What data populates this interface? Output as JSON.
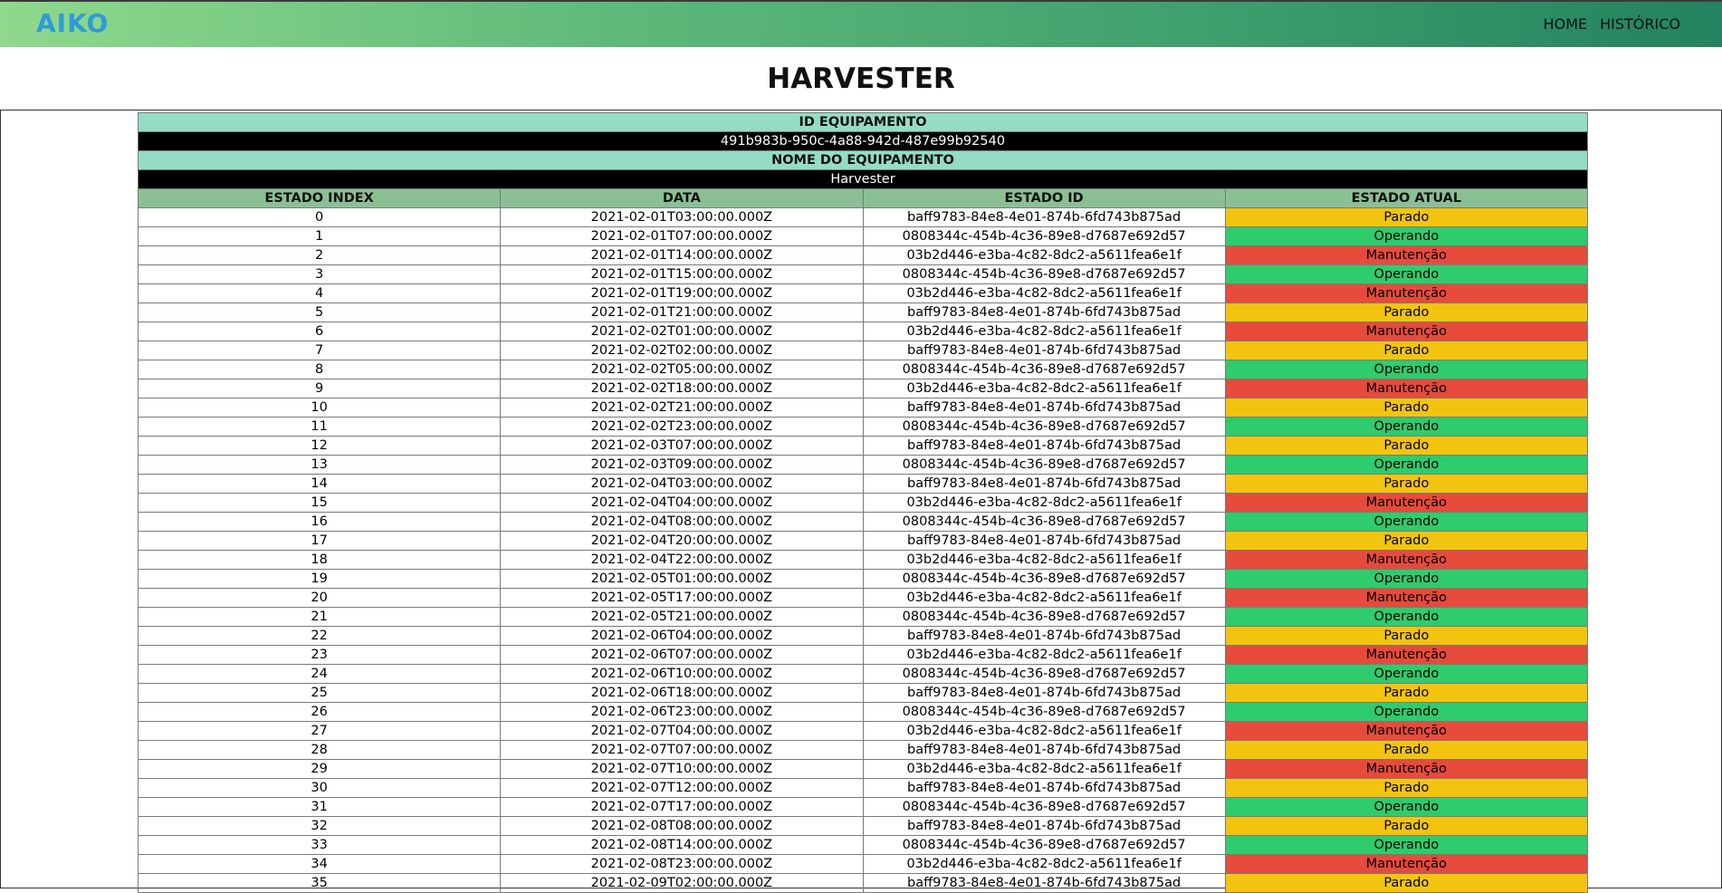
{
  "navbar": {
    "logo": "AIKO",
    "links": [
      {
        "label": "HOME"
      },
      {
        "label": "HISTÓRICO"
      }
    ]
  },
  "page": {
    "title": "HARVESTER"
  },
  "equipment": {
    "id_label": "ID EQUIPAMENTO",
    "id_value": "491b983b-950c-4a88-942d-487e99b92540",
    "name_label": "NOME DO EQUIPAMENTO",
    "name_value": "Harvester"
  },
  "table": {
    "headers": [
      "ESTADO INDEX",
      "DATA",
      "ESTADO ID",
      "ESTADO ATUAL"
    ],
    "state_colors": {
      "Parado": "#f3c40f",
      "Operando": "#2ecc6c",
      "Manutenção": "#e64b3c"
    },
    "rows": [
      {
        "index": "0",
        "date": "2021-02-01T03:00:00.000Z",
        "state_id": "baff9783-84e8-4e01-874b-6fd743b875ad",
        "state": "Parado"
      },
      {
        "index": "1",
        "date": "2021-02-01T07:00:00.000Z",
        "state_id": "0808344c-454b-4c36-89e8-d7687e692d57",
        "state": "Operando"
      },
      {
        "index": "2",
        "date": "2021-02-01T14:00:00.000Z",
        "state_id": "03b2d446-e3ba-4c82-8dc2-a5611fea6e1f",
        "state": "Manutenção"
      },
      {
        "index": "3",
        "date": "2021-02-01T15:00:00.000Z",
        "state_id": "0808344c-454b-4c36-89e8-d7687e692d57",
        "state": "Operando"
      },
      {
        "index": "4",
        "date": "2021-02-01T19:00:00.000Z",
        "state_id": "03b2d446-e3ba-4c82-8dc2-a5611fea6e1f",
        "state": "Manutenção"
      },
      {
        "index": "5",
        "date": "2021-02-01T21:00:00.000Z",
        "state_id": "baff9783-84e8-4e01-874b-6fd743b875ad",
        "state": "Parado"
      },
      {
        "index": "6",
        "date": "2021-02-02T01:00:00.000Z",
        "state_id": "03b2d446-e3ba-4c82-8dc2-a5611fea6e1f",
        "state": "Manutenção"
      },
      {
        "index": "7",
        "date": "2021-02-02T02:00:00.000Z",
        "state_id": "baff9783-84e8-4e01-874b-6fd743b875ad",
        "state": "Parado"
      },
      {
        "index": "8",
        "date": "2021-02-02T05:00:00.000Z",
        "state_id": "0808344c-454b-4c36-89e8-d7687e692d57",
        "state": "Operando"
      },
      {
        "index": "9",
        "date": "2021-02-02T18:00:00.000Z",
        "state_id": "03b2d446-e3ba-4c82-8dc2-a5611fea6e1f",
        "state": "Manutenção"
      },
      {
        "index": "10",
        "date": "2021-02-02T21:00:00.000Z",
        "state_id": "baff9783-84e8-4e01-874b-6fd743b875ad",
        "state": "Parado"
      },
      {
        "index": "11",
        "date": "2021-02-02T23:00:00.000Z",
        "state_id": "0808344c-454b-4c36-89e8-d7687e692d57",
        "state": "Operando"
      },
      {
        "index": "12",
        "date": "2021-02-03T07:00:00.000Z",
        "state_id": "baff9783-84e8-4e01-874b-6fd743b875ad",
        "state": "Parado"
      },
      {
        "index": "13",
        "date": "2021-02-03T09:00:00.000Z",
        "state_id": "0808344c-454b-4c36-89e8-d7687e692d57",
        "state": "Operando"
      },
      {
        "index": "14",
        "date": "2021-02-04T03:00:00.000Z",
        "state_id": "baff9783-84e8-4e01-874b-6fd743b875ad",
        "state": "Parado"
      },
      {
        "index": "15",
        "date": "2021-02-04T04:00:00.000Z",
        "state_id": "03b2d446-e3ba-4c82-8dc2-a5611fea6e1f",
        "state": "Manutenção"
      },
      {
        "index": "16",
        "date": "2021-02-04T08:00:00.000Z",
        "state_id": "0808344c-454b-4c36-89e8-d7687e692d57",
        "state": "Operando"
      },
      {
        "index": "17",
        "date": "2021-02-04T20:00:00.000Z",
        "state_id": "baff9783-84e8-4e01-874b-6fd743b875ad",
        "state": "Parado"
      },
      {
        "index": "18",
        "date": "2021-02-04T22:00:00.000Z",
        "state_id": "03b2d446-e3ba-4c82-8dc2-a5611fea6e1f",
        "state": "Manutenção"
      },
      {
        "index": "19",
        "date": "2021-02-05T01:00:00.000Z",
        "state_id": "0808344c-454b-4c36-89e8-d7687e692d57",
        "state": "Operando"
      },
      {
        "index": "20",
        "date": "2021-02-05T17:00:00.000Z",
        "state_id": "03b2d446-e3ba-4c82-8dc2-a5611fea6e1f",
        "state": "Manutenção"
      },
      {
        "index": "21",
        "date": "2021-02-05T21:00:00.000Z",
        "state_id": "0808344c-454b-4c36-89e8-d7687e692d57",
        "state": "Operando"
      },
      {
        "index": "22",
        "date": "2021-02-06T04:00:00.000Z",
        "state_id": "baff9783-84e8-4e01-874b-6fd743b875ad",
        "state": "Parado"
      },
      {
        "index": "23",
        "date": "2021-02-06T07:00:00.000Z",
        "state_id": "03b2d446-e3ba-4c82-8dc2-a5611fea6e1f",
        "state": "Manutenção"
      },
      {
        "index": "24",
        "date": "2021-02-06T10:00:00.000Z",
        "state_id": "0808344c-454b-4c36-89e8-d7687e692d57",
        "state": "Operando"
      },
      {
        "index": "25",
        "date": "2021-02-06T18:00:00.000Z",
        "state_id": "baff9783-84e8-4e01-874b-6fd743b875ad",
        "state": "Parado"
      },
      {
        "index": "26",
        "date": "2021-02-06T23:00:00.000Z",
        "state_id": "0808344c-454b-4c36-89e8-d7687e692d57",
        "state": "Operando"
      },
      {
        "index": "27",
        "date": "2021-02-07T04:00:00.000Z",
        "state_id": "03b2d446-e3ba-4c82-8dc2-a5611fea6e1f",
        "state": "Manutenção"
      },
      {
        "index": "28",
        "date": "2021-02-07T07:00:00.000Z",
        "state_id": "baff9783-84e8-4e01-874b-6fd743b875ad",
        "state": "Parado"
      },
      {
        "index": "29",
        "date": "2021-02-07T10:00:00.000Z",
        "state_id": "03b2d446-e3ba-4c82-8dc2-a5611fea6e1f",
        "state": "Manutenção"
      },
      {
        "index": "30",
        "date": "2021-02-07T12:00:00.000Z",
        "state_id": "baff9783-84e8-4e01-874b-6fd743b875ad",
        "state": "Parado"
      },
      {
        "index": "31",
        "date": "2021-02-07T17:00:00.000Z",
        "state_id": "0808344c-454b-4c36-89e8-d7687e692d57",
        "state": "Operando"
      },
      {
        "index": "32",
        "date": "2021-02-08T08:00:00.000Z",
        "state_id": "baff9783-84e8-4e01-874b-6fd743b875ad",
        "state": "Parado"
      },
      {
        "index": "33",
        "date": "2021-02-08T14:00:00.000Z",
        "state_id": "0808344c-454b-4c36-89e8-d7687e692d57",
        "state": "Operando"
      },
      {
        "index": "34",
        "date": "2021-02-08T23:00:00.000Z",
        "state_id": "03b2d446-e3ba-4c82-8dc2-a5611fea6e1f",
        "state": "Manutenção"
      },
      {
        "index": "35",
        "date": "2021-02-09T02:00:00.000Z",
        "state_id": "baff9783-84e8-4e01-874b-6fd743b875ad",
        "state": "Parado"
      }
    ]
  }
}
